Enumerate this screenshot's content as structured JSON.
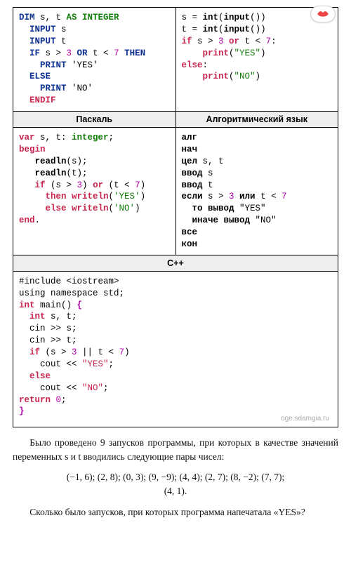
{
  "headers": {
    "pascal": "Паскаль",
    "algo": "Алгоритмический язык",
    "cpp": "С++"
  },
  "watermark": "oge.sdamgia.ru",
  "text": {
    "para1": "Было проведено 9 запусков программы, при которых в качестве значений переменных s и t вводились следующие пары чисел:",
    "pairs_line1": "(−1, 6); (2, 8); (0, 3); (9, −9); (4, 4); (2, 7); (8, −2); (7, 7);",
    "pairs_line2": "(4, 1).",
    "para2": "Сколько было запусков, при которых программа напечатала «YES»?"
  },
  "code": {
    "basic": [
      {
        "seg": [
          {
            "t": "DIM ",
            "c": "kw-blue"
          },
          {
            "t": "s, t "
          },
          {
            "t": "AS INTEGER",
            "c": "kw-green"
          }
        ]
      },
      {
        "seg": [
          {
            "t": "  INPUT ",
            "c": "kw-blue"
          },
          {
            "t": "s"
          }
        ]
      },
      {
        "seg": [
          {
            "t": "  INPUT ",
            "c": "kw-blue"
          },
          {
            "t": "t"
          }
        ]
      },
      {
        "seg": [
          {
            "t": "  IF ",
            "c": "kw-blue"
          },
          {
            "t": "s > "
          },
          {
            "t": "3",
            "c": "num-mag"
          },
          {
            "t": " OR ",
            "c": "kw-blue"
          },
          {
            "t": "t < "
          },
          {
            "t": "7",
            "c": "num-mag"
          },
          {
            "t": " THEN",
            "c": "kw-blue"
          }
        ]
      },
      {
        "seg": [
          {
            "t": "    PRINT ",
            "c": "kw-blue"
          },
          {
            "t": "'YES'"
          }
        ]
      },
      {
        "seg": [
          {
            "t": "  ELSE",
            "c": "kw-blue"
          }
        ]
      },
      {
        "seg": [
          {
            "t": "    PRINT ",
            "c": "kw-blue"
          },
          {
            "t": "'NO'"
          }
        ]
      },
      {
        "seg": [
          {
            "t": "  ENDIF",
            "c": "kw-red"
          }
        ]
      }
    ],
    "python": [
      {
        "seg": [
          {
            "t": "s = "
          },
          {
            "t": "int",
            "c": "b"
          },
          {
            "t": "("
          },
          {
            "t": "input",
            "c": "b"
          },
          {
            "t": "())"
          }
        ]
      },
      {
        "seg": [
          {
            "t": "t = "
          },
          {
            "t": "int",
            "c": "b"
          },
          {
            "t": "("
          },
          {
            "t": "input",
            "c": "b"
          },
          {
            "t": "())"
          }
        ]
      },
      {
        "seg": [
          {
            "t": "if ",
            "c": "kw-red"
          },
          {
            "t": "s > "
          },
          {
            "t": "3",
            "c": "num-mag"
          },
          {
            "t": " or ",
            "c": "kw-red"
          },
          {
            "t": "t < "
          },
          {
            "t": "7",
            "c": "num-mag"
          },
          {
            "t": ":"
          }
        ]
      },
      {
        "seg": [
          {
            "t": "    print",
            "c": "kw-red"
          },
          {
            "t": "("
          },
          {
            "t": "\"YES\"",
            "c": "str-grn"
          },
          {
            "t": ")"
          }
        ]
      },
      {
        "seg": [
          {
            "t": "else",
            "c": "kw-red"
          },
          {
            "t": ":"
          }
        ]
      },
      {
        "seg": [
          {
            "t": "    print",
            "c": "kw-red"
          },
          {
            "t": "("
          },
          {
            "t": "\"NO\"",
            "c": "str-grn"
          },
          {
            "t": ")"
          }
        ]
      }
    ],
    "pascal": [
      {
        "seg": [
          {
            "t": "var ",
            "c": "kw-red"
          },
          {
            "t": "s, t: "
          },
          {
            "t": "integer",
            "c": "kw-green"
          },
          {
            "t": ";"
          }
        ]
      },
      {
        "seg": [
          {
            "t": "begin",
            "c": "kw-red"
          }
        ]
      },
      {
        "seg": [
          {
            "t": "   readln",
            "c": "b"
          },
          {
            "t": "(s);"
          }
        ]
      },
      {
        "seg": [
          {
            "t": "   readln",
            "c": "b"
          },
          {
            "t": "(t);"
          }
        ]
      },
      {
        "seg": [
          {
            "t": "   if ",
            "c": "kw-red"
          },
          {
            "t": "(s > "
          },
          {
            "t": "3",
            "c": "num-mag"
          },
          {
            "t": ") "
          },
          {
            "t": "or",
            "c": "kw-red"
          },
          {
            "t": " (t < "
          },
          {
            "t": "7",
            "c": "num-mag"
          },
          {
            "t": ")"
          }
        ]
      },
      {
        "seg": [
          {
            "t": "     then writeln",
            "c": "kw-red"
          },
          {
            "t": "("
          },
          {
            "t": "'YES'",
            "c": "str-grn"
          },
          {
            "t": ")"
          }
        ]
      },
      {
        "seg": [
          {
            "t": "     else writeln",
            "c": "kw-red"
          },
          {
            "t": "("
          },
          {
            "t": "'NO'",
            "c": "str-grn"
          },
          {
            "t": ")"
          }
        ]
      },
      {
        "seg": [
          {
            "t": "end",
            "c": "kw-red"
          },
          {
            "t": "."
          }
        ]
      }
    ],
    "algo": [
      {
        "seg": [
          {
            "t": "алг",
            "c": "b"
          }
        ]
      },
      {
        "seg": [
          {
            "t": "нач",
            "c": "b"
          }
        ]
      },
      {
        "seg": [
          {
            "t": "цел ",
            "c": "b"
          },
          {
            "t": "s, t"
          }
        ]
      },
      {
        "seg": [
          {
            "t": "ввод ",
            "c": "b"
          },
          {
            "t": "s"
          }
        ]
      },
      {
        "seg": [
          {
            "t": "ввод ",
            "c": "b"
          },
          {
            "t": "t"
          }
        ]
      },
      {
        "seg": [
          {
            "t": "если ",
            "c": "b"
          },
          {
            "t": "s > "
          },
          {
            "t": "3",
            "c": "num-mag"
          },
          {
            "t": " или ",
            "c": "b"
          },
          {
            "t": "t < "
          },
          {
            "t": "7",
            "c": "num-mag"
          }
        ]
      },
      {
        "seg": [
          {
            "t": "  то вывод ",
            "c": "b"
          },
          {
            "t": "\"YES\""
          }
        ]
      },
      {
        "seg": [
          {
            "t": "  иначе вывод ",
            "c": "b"
          },
          {
            "t": "\"NO\""
          }
        ]
      },
      {
        "seg": [
          {
            "t": "все",
            "c": "b"
          }
        ]
      },
      {
        "seg": [
          {
            "t": "кон",
            "c": "b"
          }
        ]
      }
    ],
    "cpp": [
      {
        "seg": [
          {
            "t": "#include <iostream>"
          }
        ]
      },
      {
        "seg": [
          {
            "t": "using namespace std;"
          }
        ]
      },
      {
        "seg": [
          {
            "t": "int ",
            "c": "kw-red"
          },
          {
            "t": "main() "
          },
          {
            "t": "{",
            "c": "kw-mag"
          }
        ]
      },
      {
        "seg": [
          {
            "t": "  int ",
            "c": "kw-red"
          },
          {
            "t": "s, t;"
          }
        ]
      },
      {
        "seg": [
          {
            "t": "  cin >> s;"
          }
        ]
      },
      {
        "seg": [
          {
            "t": "  cin >> t;"
          }
        ]
      },
      {
        "seg": [
          {
            "t": "  if ",
            "c": "kw-red"
          },
          {
            "t": "(s > "
          },
          {
            "t": "3",
            "c": "num-mag"
          },
          {
            "t": " || t < "
          },
          {
            "t": "7",
            "c": "num-mag"
          },
          {
            "t": ")"
          }
        ]
      },
      {
        "seg": [
          {
            "t": "    cout << "
          },
          {
            "t": "\"YES\"",
            "c": "str-red"
          },
          {
            "t": ";"
          }
        ]
      },
      {
        "seg": [
          {
            "t": "  else",
            "c": "kw-red"
          }
        ]
      },
      {
        "seg": [
          {
            "t": "    cout << "
          },
          {
            "t": "\"NO\"",
            "c": "str-red"
          },
          {
            "t": ";"
          }
        ]
      },
      {
        "seg": [
          {
            "t": "return ",
            "c": "kw-red"
          },
          {
            "t": "0",
            "c": "num-mag"
          },
          {
            "t": ";"
          }
        ]
      },
      {
        "seg": [
          {
            "t": "}",
            "c": "kw-mag"
          }
        ]
      }
    ]
  }
}
